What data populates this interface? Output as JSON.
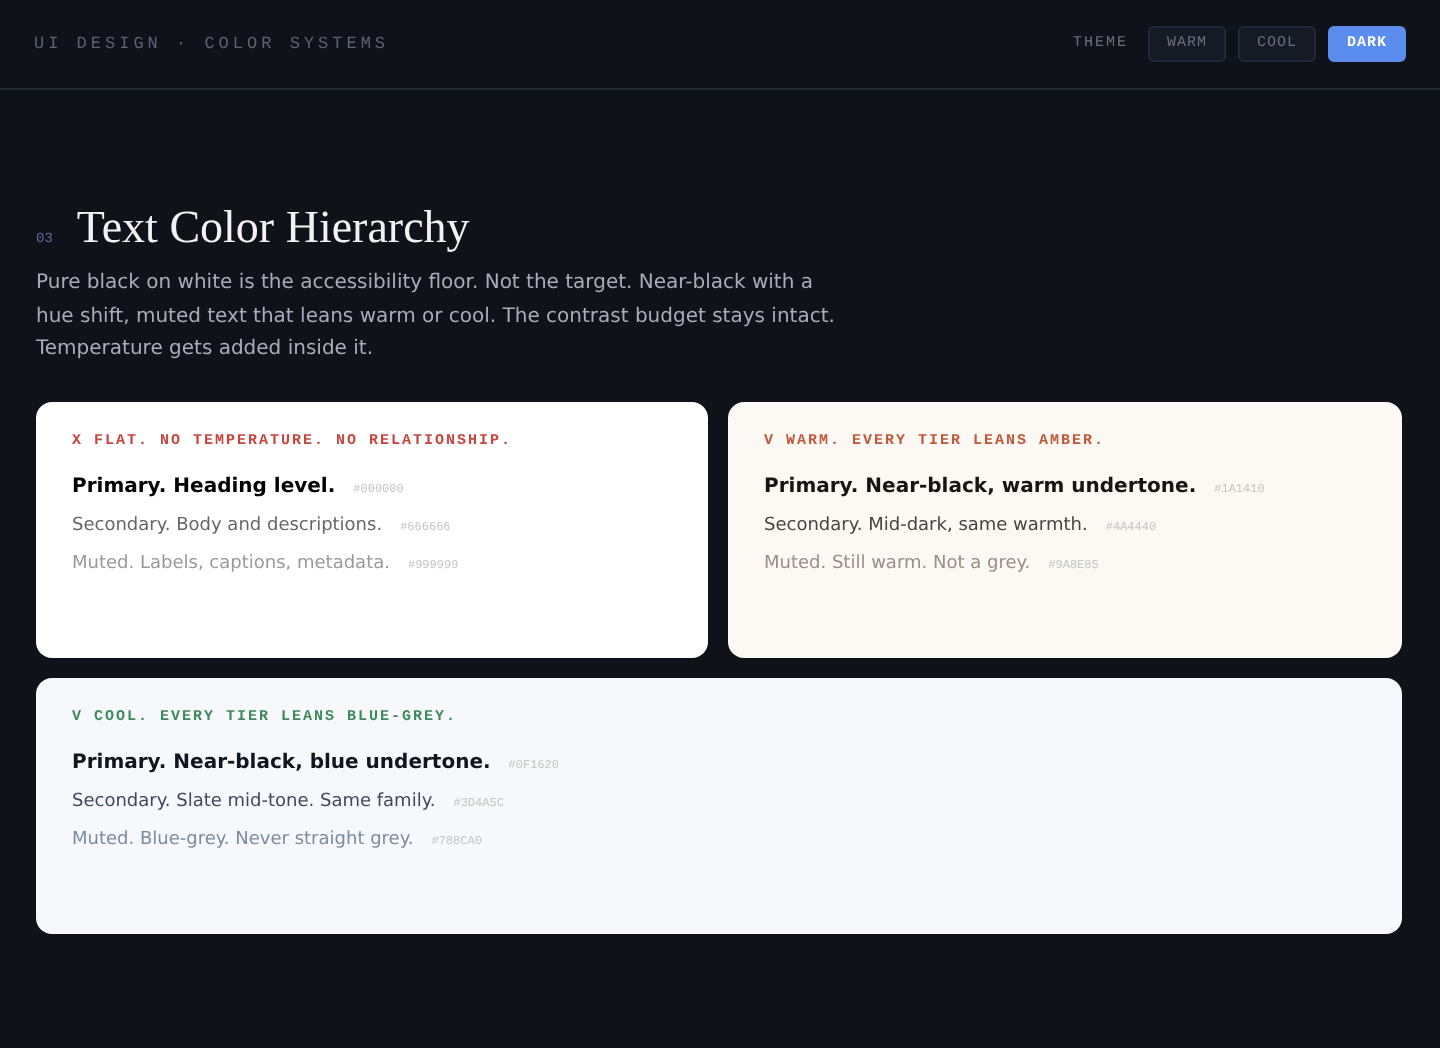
{
  "header": {
    "breadcrumb": "UI DESIGN · COLOR SYSTEMS",
    "theme_label": "THEME",
    "themes": [
      {
        "label": "WARM",
        "selected": false
      },
      {
        "label": "COOL",
        "selected": false
      },
      {
        "label": "DARK",
        "selected": true
      }
    ]
  },
  "section": {
    "number": "03",
    "title": "Text Color Hierarchy",
    "description": "Pure black on white is the accessibility floor. Not the target. Near-black with a hue shift, muted text that leans warm or cool. The contrast budget stays intact. Temperature gets added inside it."
  },
  "cards": [
    {
      "kind": "flat",
      "verdict": "X",
      "caption": "FLAT. NO TEMPERATURE. NO RELATIONSHIP.",
      "tiers": [
        {
          "text": "Primary. Heading level.",
          "code": "#000000",
          "color": "#000000"
        },
        {
          "text": "Secondary. Body and descriptions.",
          "code": "#666666",
          "color": "#666666"
        },
        {
          "text": "Muted. Labels, captions, metadata.",
          "code": "#999999",
          "color": "#999999"
        }
      ]
    },
    {
      "kind": "warm",
      "verdict": "V",
      "caption": "WARM. EVERY TIER LEANS AMBER.",
      "tiers": [
        {
          "text": "Primary. Near-black, warm undertone.",
          "code": "#1A1410",
          "color": "#1a1410"
        },
        {
          "text": "Secondary. Mid-dark, same warmth.",
          "code": "#4A4440",
          "color": "#4a4440"
        },
        {
          "text": "Muted. Still warm. Not a grey.",
          "code": "#9A8E85",
          "color": "#9a8e85"
        }
      ]
    },
    {
      "kind": "cool",
      "verdict": "V",
      "caption": "COOL. EVERY TIER LEANS BLUE-GREY.",
      "tiers": [
        {
          "text": "Primary. Near-black, blue undertone.",
          "code": "#0F1620",
          "color": "#0f1620"
        },
        {
          "text": "Secondary. Slate mid-tone. Same family.",
          "code": "#3D4A5C",
          "color": "#3d4a5c"
        },
        {
          "text": "Muted. Blue-grey. Never straight grey.",
          "code": "#788CA0",
          "color": "#788ca0"
        }
      ]
    }
  ]
}
